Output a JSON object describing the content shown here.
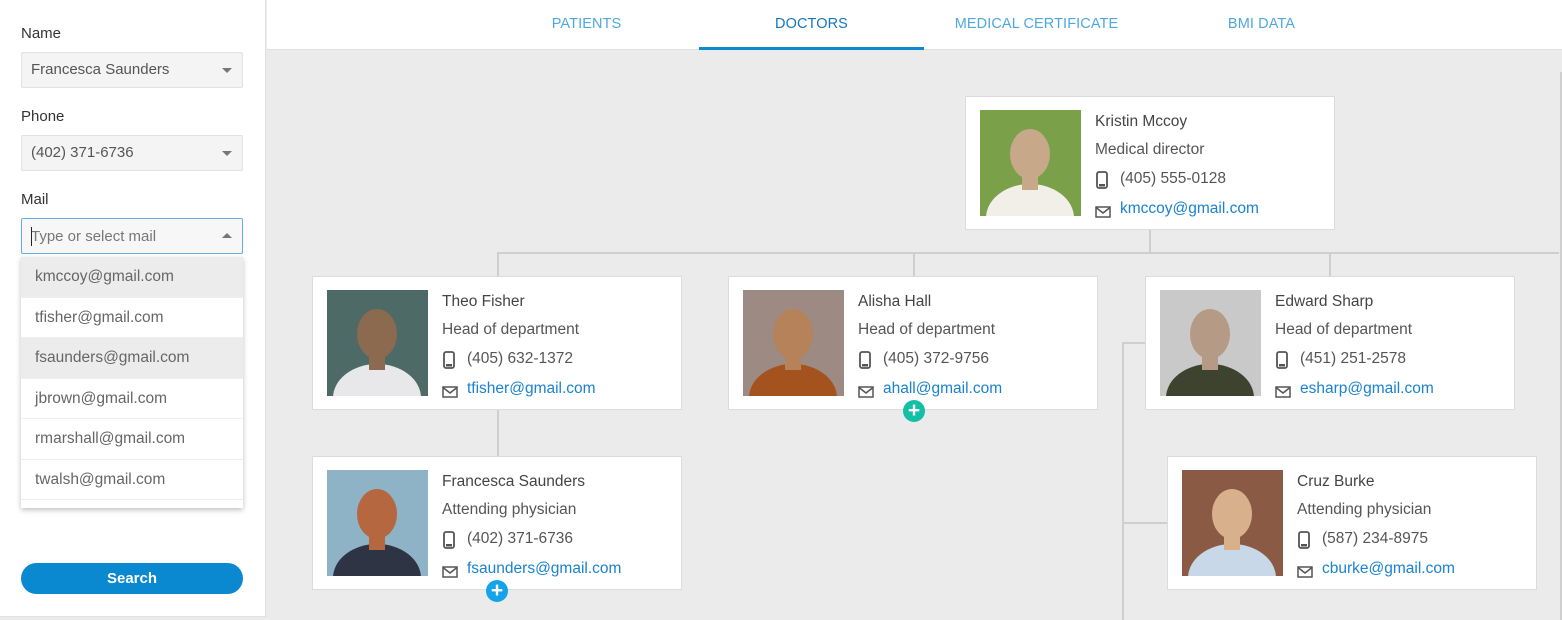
{
  "sidebar": {
    "name_label": "Name",
    "name_value": "Francesca Saunders",
    "phone_label": "Phone",
    "phone_value": "(402) 371-6736",
    "mail_label": "Mail",
    "mail_placeholder": "Type or select mail",
    "mail_value": "",
    "mail_options": [
      "kmccoy@gmail.com",
      "tfisher@gmail.com",
      "fsaunders@gmail.com",
      "jbrown@gmail.com",
      "rmarshall@gmail.com",
      "twalsh@gmail.com"
    ],
    "search_label": "Search"
  },
  "tabs": [
    {
      "label": "PATIENTS",
      "active": false
    },
    {
      "label": "DOCTORS",
      "active": true
    },
    {
      "label": "MEDICAL CERTIFICATE",
      "active": false
    },
    {
      "label": "BMI DATA",
      "active": false
    }
  ],
  "doctors": [
    {
      "name": "Kristin Mccoy",
      "role": "Medical director",
      "phone": "(405) 555-0128",
      "email": "kmccoy@gmail.com"
    },
    {
      "name": "Theo Fisher",
      "role": "Head of department",
      "phone": "(405) 632-1372",
      "email": "tfisher@gmail.com"
    },
    {
      "name": "Alisha Hall",
      "role": "Head of department",
      "phone": "(405) 372-9756",
      "email": "ahall@gmail.com"
    },
    {
      "name": "Edward Sharp",
      "role": "Head of department",
      "phone": "(451) 251-2578",
      "email": "esharp@gmail.com"
    },
    {
      "name": "Francesca Saunders",
      "role": "Attending physician",
      "phone": "(402) 371-6736",
      "email": "fsaunders@gmail.com"
    },
    {
      "name": "Cruz Burke",
      "role": "Attending physician",
      "phone": "(587) 234-8975",
      "email": "cburke@gmail.com"
    }
  ],
  "icons": {
    "phone": "mobile-phone-icon",
    "mail": "envelope-icon",
    "expand": "plus-circle-icon"
  },
  "colors": {
    "accent": "#0a88d0",
    "tab_inactive": "#4ea8de",
    "link": "#1a82cf",
    "expand_teal": "#13bfa6",
    "expand_blue": "#12a3e8"
  }
}
